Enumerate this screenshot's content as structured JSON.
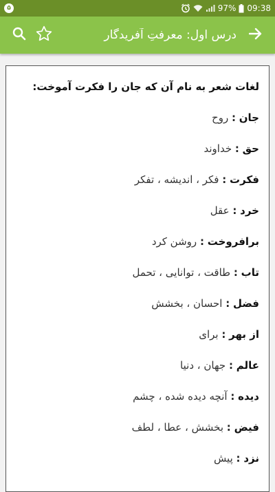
{
  "status_bar": {
    "notification_count": "۵",
    "battery": "97%",
    "time": "09:38"
  },
  "app_bar": {
    "title": "درس اول: معرفتِ آفریدگار",
    "accent_color": "#8bc34a"
  },
  "content": {
    "heading": "لغات شعر به نام آن که جان را فکرت آموخت:",
    "separator": ":",
    "items": [
      {
        "term": "جان",
        "meaning": "روح"
      },
      {
        "term": "حق",
        "meaning": "خداوند"
      },
      {
        "term": "فکرت",
        "meaning": "فکر ، اندیشه ، تفکر"
      },
      {
        "term": "خرد",
        "meaning": "عقل"
      },
      {
        "term": "برافروخت",
        "meaning": "روشن کرد"
      },
      {
        "term": "تاب",
        "meaning": "طاقت ، توانایی ، تحمل"
      },
      {
        "term": "فضل",
        "meaning": "احسان ، بخشش"
      },
      {
        "term": "از بهر",
        "meaning": "برای"
      },
      {
        "term": "عالم",
        "meaning": "جهان ، دنیا"
      },
      {
        "term": "دیده",
        "meaning": "آنچه دیده شده ، چشم"
      },
      {
        "term": "فیض",
        "meaning": "بخشش ، عطا ، لطف"
      },
      {
        "term": "نزد",
        "meaning": "پیش"
      }
    ]
  }
}
